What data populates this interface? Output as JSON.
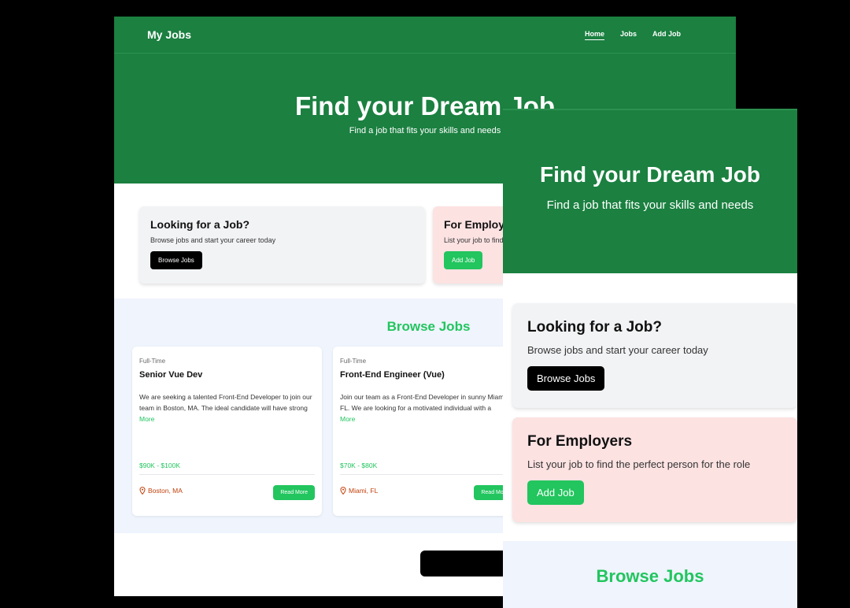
{
  "desktop": {
    "nav": {
      "brand": "My Jobs",
      "links": [
        "Home",
        "Jobs",
        "Add Job"
      ]
    },
    "hero": {
      "title": "Find your Dream Job",
      "subtitle": "Find a job that fits your skills and needs"
    },
    "cards": [
      {
        "title": "Looking for a Job?",
        "text": "Browse jobs and start your career today",
        "button": "Browse Jobs"
      },
      {
        "title": "For Employers",
        "text": "List your job to find the perfect person for the role",
        "button": "Add Job"
      }
    ],
    "browse_title": "Browse Jobs",
    "jobs": [
      {
        "type": "Full-Time",
        "title": "Senior Vue Dev",
        "description": "We are seeking a talented Front-End Developer to join our team in Boston, MA. The ideal candidate will have strong skills in HTML, CSS, and JavaScript...",
        "more": "More",
        "salary": "$90K - $100K",
        "location": "Boston, MA",
        "button": "Read More"
      },
      {
        "type": "Full-Time",
        "title": "Front-End Engineer (Vue)",
        "description": "Join our team as a Front-End Developer in sunny Miami, FL. We are looking for a motivated individual with a passion for crafting beautiful and respons...",
        "more": "More",
        "salary": "$70K - $80K",
        "location": "Miami, FL",
        "button": "Read More"
      }
    ],
    "view_all": "View All Jobs"
  },
  "mobile": {
    "hero": {
      "title": "Find your Dream Job",
      "subtitle": "Find a job that fits your skills and needs"
    },
    "cards": [
      {
        "title": "Looking for a Job?",
        "text": "Browse jobs and start your career today",
        "button": "Browse Jobs"
      },
      {
        "title": "For Employers",
        "text": "List your job to find the perfect person for the role",
        "button": "Add Job"
      }
    ],
    "browse_title": "Browse Jobs"
  },
  "colors": {
    "brand_green": "#1b8040",
    "accent_green": "#22c55e",
    "card_gray": "#f2f3f5",
    "card_pink": "#fde2e2",
    "browse_bg": "#eff4fd",
    "location_orange": "#c2410c"
  },
  "icons": {
    "location": "map-pin-icon"
  }
}
